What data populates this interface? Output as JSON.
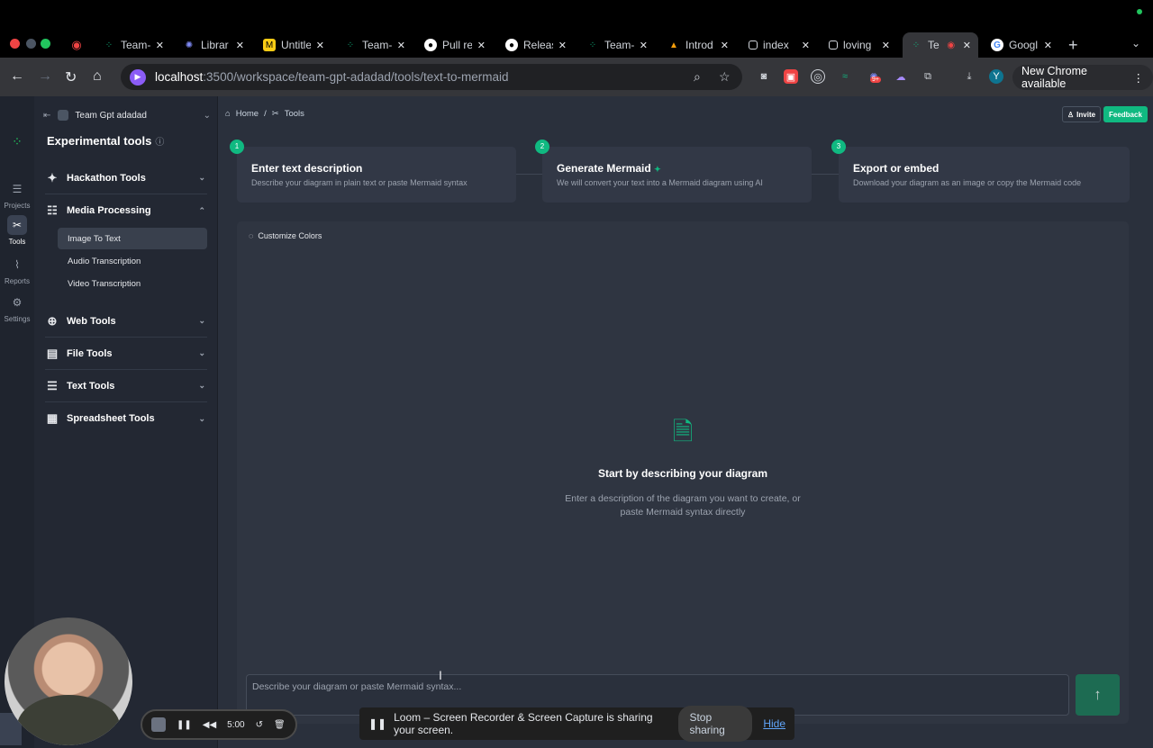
{
  "browser": {
    "tabs": [
      {
        "title": "Team-",
        "icon": "teamgpt-icon"
      },
      {
        "title": "Librar",
        "icon": "library-icon"
      },
      {
        "title": "Untitle",
        "icon": "miro-icon"
      },
      {
        "title": "Team-",
        "icon": "teamgpt-icon"
      },
      {
        "title": "Pull re",
        "icon": "github-icon"
      },
      {
        "title": "Releas",
        "icon": "github-icon"
      },
      {
        "title": "Team-",
        "icon": "teamgpt-icon"
      },
      {
        "title": "Introd",
        "icon": "intro-icon"
      },
      {
        "title": "index",
        "icon": "page-icon"
      },
      {
        "title": "loving",
        "icon": "page-icon"
      },
      {
        "title": "Te",
        "icon": "teamgpt-icon"
      },
      {
        "title": "Googl",
        "icon": "google-icon"
      }
    ],
    "url_host": "localhost",
    "url_path": ":3500/workspace/team-gpt-adadad/tools/text-to-mermaid",
    "new_chrome": "New Chrome available",
    "profile_initial": "Y",
    "ext_badge": "9+"
  },
  "rail": {
    "items": [
      {
        "label": "Projects"
      },
      {
        "label": "Tools"
      },
      {
        "label": "Reports"
      },
      {
        "label": "Settings"
      }
    ]
  },
  "sidebar": {
    "workspace": "Team Gpt adadad",
    "title": "Experimental tools",
    "groups": [
      {
        "label": "Hackathon Tools"
      },
      {
        "label": "Media Processing"
      },
      {
        "label": "Web Tools"
      },
      {
        "label": "File Tools"
      },
      {
        "label": "Text Tools"
      },
      {
        "label": "Spreadsheet Tools"
      }
    ],
    "media_items": [
      {
        "label": "Image To Text"
      },
      {
        "label": "Audio Transcription"
      },
      {
        "label": "Video Transcription"
      }
    ]
  },
  "header": {
    "home": "Home",
    "sep": "/",
    "tools": "Tools",
    "invite": "Invite",
    "feedback": "Feedback"
  },
  "steps": [
    {
      "num": "1",
      "title": "Enter text description",
      "desc": "Describe your diagram in plain text or paste Mermaid syntax"
    },
    {
      "num": "2",
      "title": "Generate Mermaid",
      "desc": "We will convert your text into a Mermaid diagram using AI"
    },
    {
      "num": "3",
      "title": "Export or embed",
      "desc": "Download your diagram as an image or copy the Mermaid code"
    }
  ],
  "canvas": {
    "customize": "Customize Colors",
    "empty_title": "Start by describing your diagram",
    "empty_line1": "Enter a description of the diagram you want to create, or",
    "empty_line2": "paste Mermaid syntax directly"
  },
  "prompt": {
    "placeholder": "Describe your diagram or paste Mermaid syntax..."
  },
  "loom": {
    "timer": "5:00",
    "share_text": "Loom – Screen Recorder & Screen Capture is sharing your screen.",
    "stop_sharing": "Stop sharing",
    "hide": "Hide"
  },
  "colors": {
    "accent": "#10b981",
    "background": "#2a303c",
    "sidebar": "#232833"
  }
}
